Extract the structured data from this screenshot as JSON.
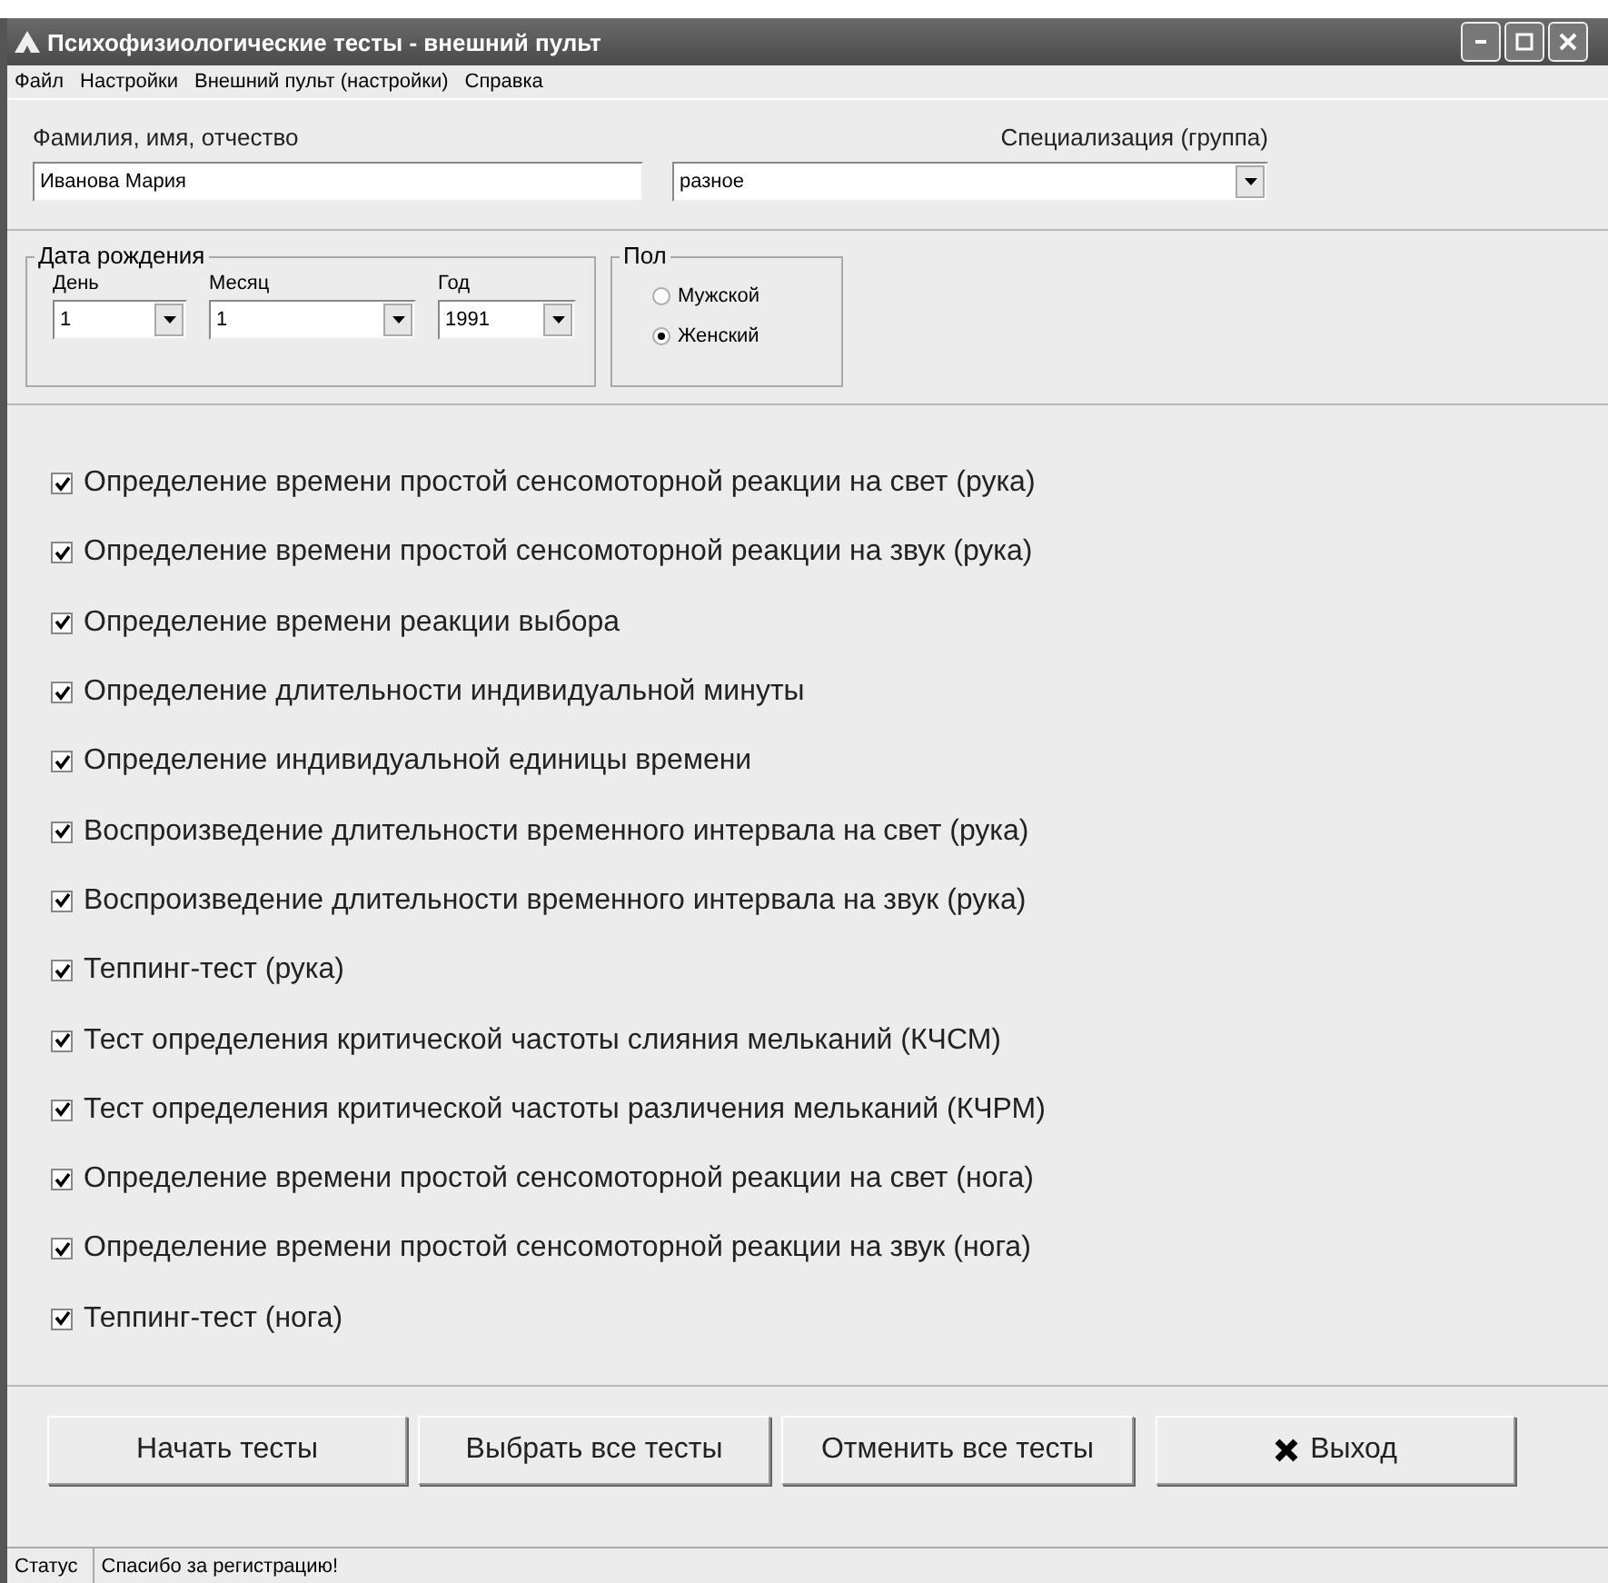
{
  "window": {
    "title": "Психофизиологические тесты - внешний пульт"
  },
  "menu": [
    "Файл",
    "Настройки",
    "Внешний пульт (настройки)",
    "Справка"
  ],
  "name_field": {
    "label": "Фамилия, имя, отчество",
    "value": "Иванова Мария"
  },
  "specialization": {
    "label": "Специализация (группа)",
    "value": "разное"
  },
  "birth_date": {
    "title": "Дата рождения",
    "fields": [
      {
        "label": "День",
        "value": "1"
      },
      {
        "label": "Месяц",
        "value": "1"
      },
      {
        "label": "Год",
        "value": "1991"
      }
    ]
  },
  "gender": {
    "title": "Пол",
    "options": [
      {
        "label": "Мужской",
        "selected": false
      },
      {
        "label": "Женский",
        "selected": true
      }
    ]
  },
  "tests": [
    {
      "label": "Определение времени простой сенсомоторной реакции на свет (рука)",
      "checked": true
    },
    {
      "label": "Определение времени простой сенсомоторной реакции на звук (рука)",
      "checked": true
    },
    {
      "label": "Определение времени реакции выбора",
      "checked": true
    },
    {
      "label": "Определение длительности индивидуальной минуты",
      "checked": true
    },
    {
      "label": "Определение индивидуальной единицы времени",
      "checked": true
    },
    {
      "label": "Воспроизведение длительности временного интервала на свет (рука)",
      "checked": true
    },
    {
      "label": "Воспроизведение длительности временного интервала на звук (рука)",
      "checked": true
    },
    {
      "label": "Теппинг-тест (рука)",
      "checked": true
    },
    {
      "label": "Тест определения критической частоты слияния мельканий (КЧСМ)",
      "checked": true
    },
    {
      "label": "Тест определения критической частоты различения мельканий (КЧРМ)",
      "checked": true
    },
    {
      "label": "Определение времени простой сенсомоторной реакции на свет (нога)",
      "checked": true
    },
    {
      "label": "Определение времени простой сенсомоторной реакции на звук (нога)",
      "checked": true
    },
    {
      "label": "Теппинг-тест (нога)",
      "checked": true
    }
  ],
  "buttons": [
    {
      "label": "Начать тесты",
      "kind": "plain"
    },
    {
      "label": "Выбрать все тесты",
      "kind": "plain"
    },
    {
      "label": "Отменить все тесты",
      "kind": "plain"
    },
    {
      "label": "Выход",
      "kind": "exit"
    }
  ],
  "status_bar": {
    "label": "Статус",
    "message": "Спасибо за регистрацию!"
  }
}
